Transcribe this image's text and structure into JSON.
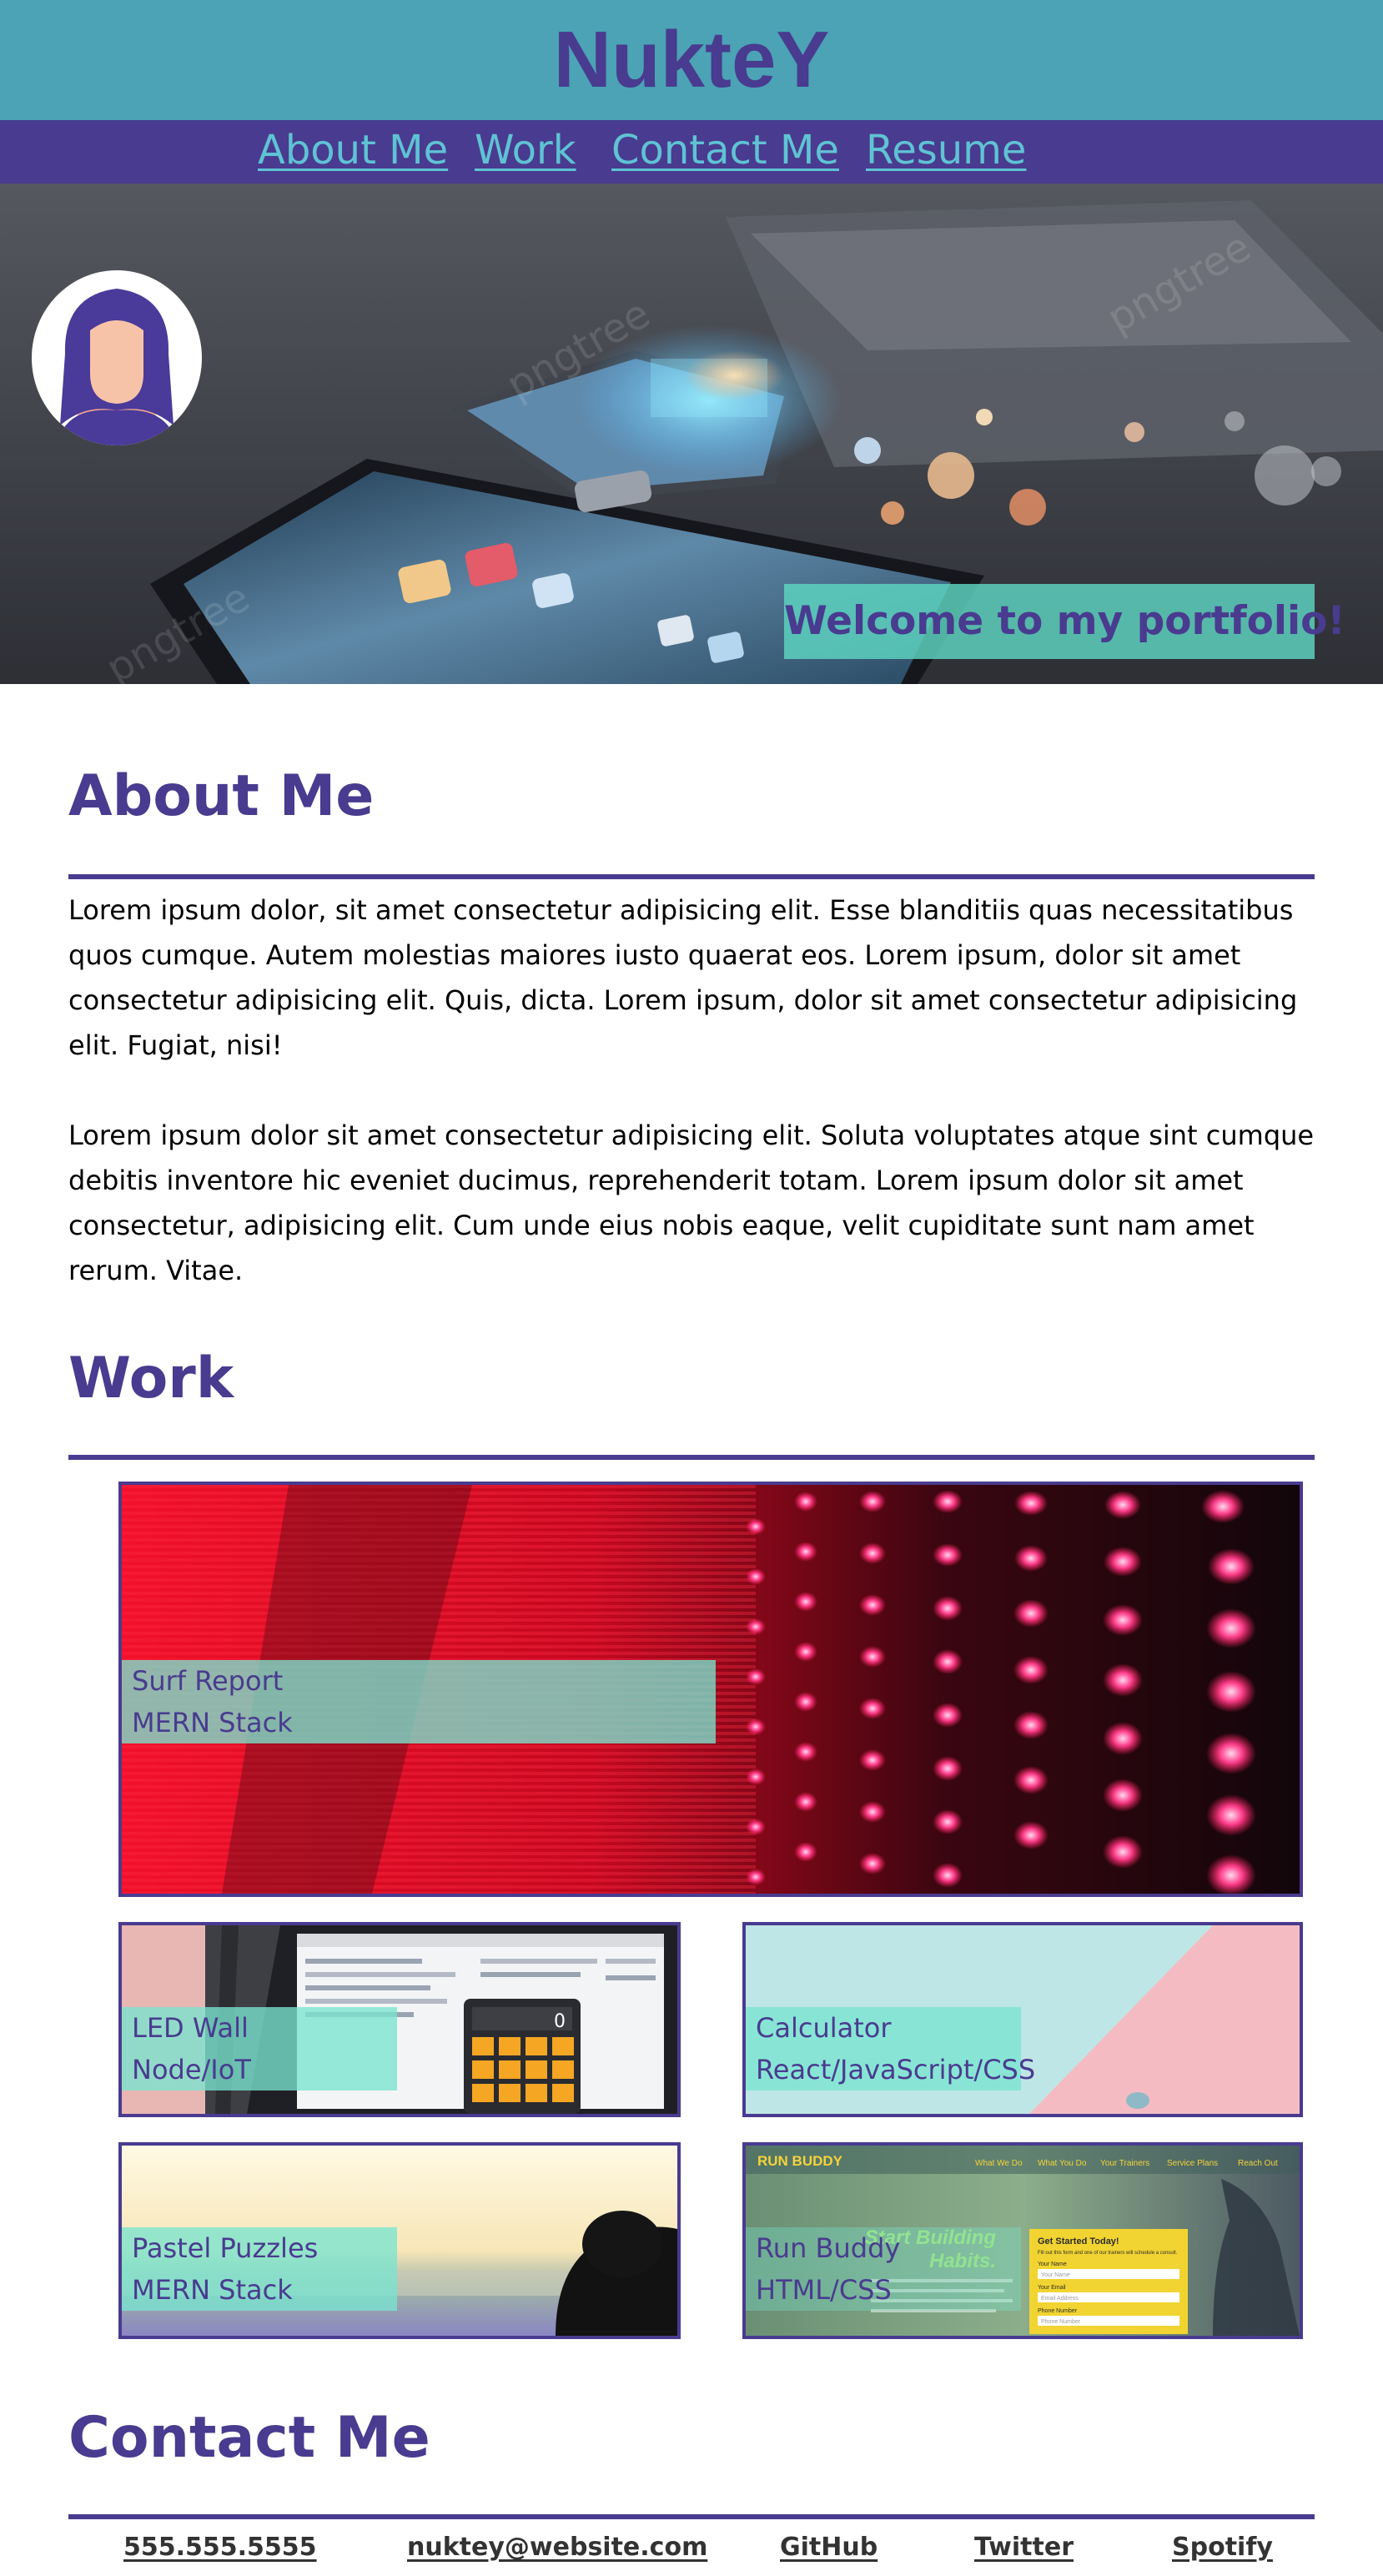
{
  "header": {
    "title": "NukteY"
  },
  "nav": {
    "items": [
      {
        "label": "About Me"
      },
      {
        "label": "Work"
      },
      {
        "label": "Contact Me"
      },
      {
        "label": "Resume"
      }
    ]
  },
  "hero": {
    "welcome": "Welcome to my portfolio!",
    "watermark": "pngtree"
  },
  "about": {
    "heading": "About Me",
    "paragraphs": [
      "Lorem ipsum dolor, sit amet consectetur adipisicing elit. Esse blanditiis quas necessitatibus quos cumque. Autem molestias maiores iusto quaerat eos. Lorem ipsum, dolor sit amet consectetur adipisicing elit. Quis, dicta. Lorem ipsum, dolor sit amet consectetur adipisicing elit. Fugiat, nisi!",
      "Lorem ipsum dolor sit amet consectetur adipisicing elit. Soluta voluptates atque sint cumque debitis inventore hic eveniet ducimus, reprehenderit totam. Lorem ipsum dolor sit amet consectetur, adipisicing elit. Cum unde eius nobis eaque, velit cupiditate sunt nam amet rerum. Vitae."
    ]
  },
  "work": {
    "heading": "Work",
    "projects": [
      {
        "title": "Surf Report",
        "stack": "MERN Stack"
      },
      {
        "title": "LED Wall",
        "stack": "Node/IoT"
      },
      {
        "title": "Calculator",
        "stack": "React/JavaScript/CSS"
      },
      {
        "title": "Pastel Puzzles",
        "stack": "MERN Stack"
      },
      {
        "title": "Run Buddy",
        "stack": "HTML/CSS"
      }
    ],
    "thumbnails": {
      "calculator_display": "0",
      "run_buddy": {
        "logo": "RUN BUDDY",
        "nav": [
          "What We Do",
          "What You Do",
          "Your Trainers",
          "Service Plans",
          "Reach Out"
        ],
        "hero_text": [
          "Start Building",
          "Habits."
        ],
        "form_title": "Get Started Today!",
        "form_desc": "Fill out this form and one of our trainers will schedule a consult.",
        "form_fields": [
          {
            "label": "Your Name",
            "placeholder": "Your Name"
          },
          {
            "label": "Your Email",
            "placeholder": "Email Address"
          },
          {
            "label": "Phone Number",
            "placeholder": "Phone Number"
          }
        ]
      }
    }
  },
  "contact": {
    "heading": "Contact Me",
    "links": [
      "555.555.5555",
      "nuktey@website.com",
      "GitHub",
      "Twitter",
      "Spotify"
    ]
  },
  "colors": {
    "brand": "#493b8f",
    "header": "#4ba3b5",
    "accent": "#5ed6c2",
    "nav_link": "#5fc3d4"
  },
  "icons": {
    "avatar": "user-avatar-icon"
  }
}
